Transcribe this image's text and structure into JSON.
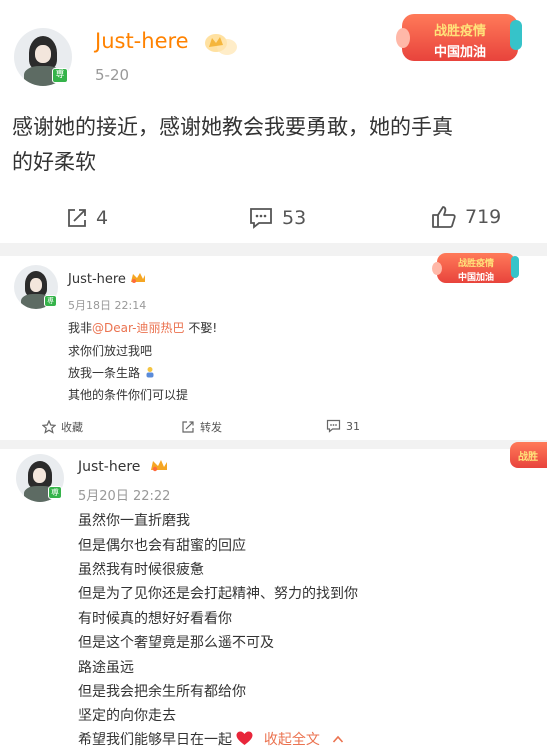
{
  "post1": {
    "username": "Just-here",
    "date": "5-20",
    "text_line1": "感谢她的接近，感谢她教会我要勇敢，她的手真",
    "text_line2": "的好柔软",
    "actions": {
      "repost": "4",
      "comment": "53",
      "like": "719"
    },
    "banner": {
      "line1": "战胜疫情",
      "line2": "中国加油"
    }
  },
  "post2": {
    "username": "Just-here",
    "date": "5月18日 22:14",
    "line1_prefix": "我非",
    "line1_mention": "@Dear-迪丽热巴",
    "line1_suffix": " 不娶!",
    "line2": "求你们放过我吧",
    "line3": "放我一条生路",
    "line4": "其他的条件你们可以提",
    "actions": {
      "favorite": "收藏",
      "repost": "转发",
      "comment": "31"
    },
    "banner": {
      "line1": "战胜疫情",
      "line2": "中国加油"
    }
  },
  "post3": {
    "username": "Just-here",
    "date": "5月20日 22:22",
    "lines": [
      "虽然你一直折磨我",
      "但是偶尔也会有甜蜜的回应",
      "虽然我有时候很疲惫",
      "但是为了见你还是会打起精神、努力的找到你",
      "有时候真的想好好看看你",
      "但是这个奢望竟是那么遥不可及",
      "路途虽远",
      "但是我会把余生所有都给你",
      "坚定的向你走去",
      "希望我们能够早日在一起"
    ],
    "collapse": "收起全文",
    "banner": {
      "line1": "战胜"
    }
  },
  "colors": {
    "accent": "#ff8200",
    "link": "#eb7350",
    "badge_green": "#35b34a"
  }
}
